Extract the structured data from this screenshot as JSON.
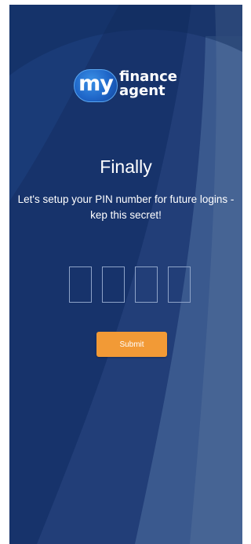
{
  "brand": {
    "logo_circle_text": "my",
    "logo_word_1": "finance",
    "logo_word_2": "agent"
  },
  "screen": {
    "title": "Finally",
    "subtitle": "Let's setup your PIN number for future logins - kep this secret!"
  },
  "pin": {
    "digits": [
      "",
      "",
      "",
      ""
    ]
  },
  "actions": {
    "submit_label": "Submit"
  },
  "colors": {
    "background_dark": "#17336b",
    "accent_orange": "#f29a36",
    "pin_border": "#8ea3c8"
  }
}
